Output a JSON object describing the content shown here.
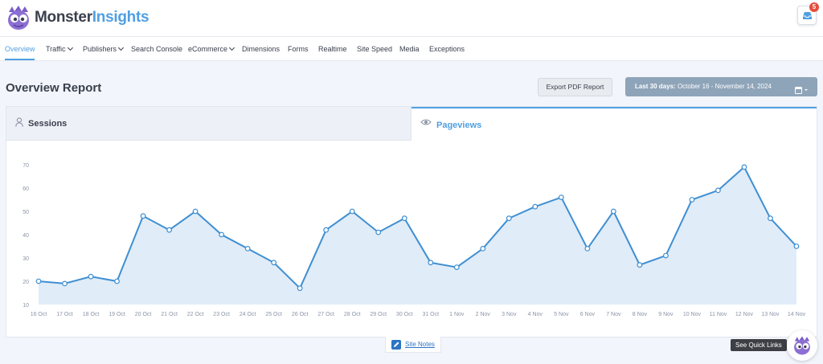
{
  "brand": {
    "name_part1": "Monster",
    "name_part2": "Insights"
  },
  "notifications": {
    "count": "5"
  },
  "nav": [
    {
      "label": "Overview",
      "active": true,
      "dropdown": false
    },
    {
      "label": "Traffic",
      "dropdown": true
    },
    {
      "label": "Publishers",
      "dropdown": true
    },
    {
      "label": "Search Console",
      "dropdown": false
    },
    {
      "label": "eCommerce",
      "dropdown": true
    },
    {
      "label": "Dimensions",
      "dropdown": false
    },
    {
      "label": "Forms",
      "dropdown": false
    },
    {
      "label": "Realtime",
      "dropdown": false
    },
    {
      "label": "Site Speed",
      "dropdown": false
    },
    {
      "label": "Media",
      "dropdown": false
    },
    {
      "label": "Exceptions",
      "dropdown": false
    }
  ],
  "page": {
    "title": "Overview Report"
  },
  "toolbar": {
    "export_label": "Export PDF Report",
    "date_prefix": "Last 30 days:",
    "date_range": "October 16 - November 14, 2024"
  },
  "tabs": {
    "sessions": "Sessions",
    "pageviews": "Pageviews"
  },
  "chart_data": {
    "type": "area",
    "categories": [
      "16 Oct",
      "17 Oct",
      "18 Oct",
      "19 Oct",
      "20 Oct",
      "21 Oct",
      "22 Oct",
      "23 Oct",
      "24 Oct",
      "25 Oct",
      "26 Oct",
      "27 Oct",
      "28 Oct",
      "29 Oct",
      "30 Oct",
      "31 Oct",
      "1 Nov",
      "2 Nov",
      "3 Nov",
      "4 Nov",
      "5 Nov",
      "6 Nov",
      "7 Nov",
      "8 Nov",
      "9 Nov",
      "10 Nov",
      "11 Nov",
      "12 Nov",
      "13 Nov",
      "14 Nov"
    ],
    "values": [
      20,
      19,
      22,
      20,
      48,
      42,
      50,
      40,
      34,
      28,
      17,
      42,
      50,
      41,
      47,
      28,
      26,
      34,
      47,
      52,
      56,
      34,
      50,
      27,
      31,
      55,
      59,
      69,
      47,
      35
    ],
    "yticks": [
      10,
      20,
      30,
      40,
      50,
      60,
      70
    ],
    "ylim": [
      10,
      70
    ],
    "grid": false,
    "line_color": "#3f8fd2",
    "fill_color": "#dbe9f7"
  },
  "footer": {
    "site_notes": "Site Notes",
    "quick_links": "See Quick Links"
  },
  "colors": {
    "accent": "#509fe2",
    "date_button": "#8ea4b9",
    "badge": "#e54d3d"
  }
}
